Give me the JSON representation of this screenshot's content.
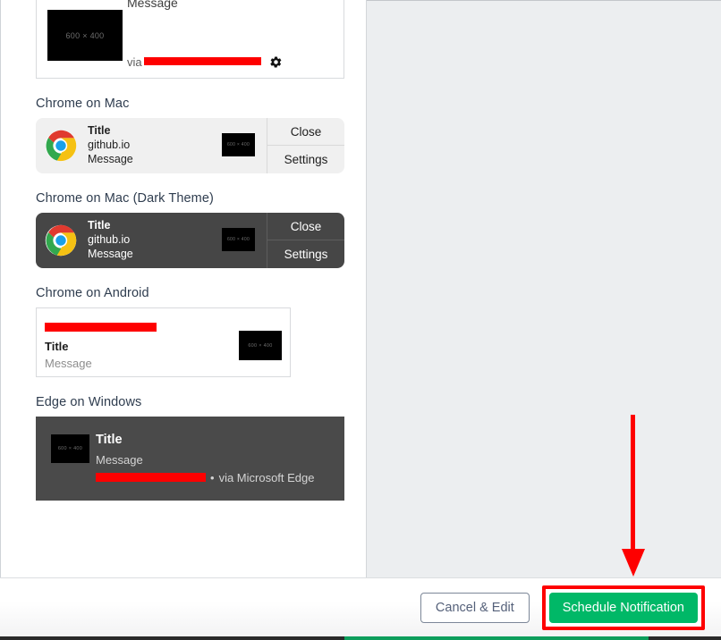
{
  "preview": {
    "sections": [
      {
        "heading": "",
        "type": "safari-partial",
        "card": {
          "message": "Message",
          "via_prefix": "via",
          "via_source": "[redacted]",
          "thumb_label": "600 × 400",
          "gear_icon": "gear-icon"
        }
      },
      {
        "heading": "Chrome on Mac",
        "type": "chrome-mac-light",
        "card": {
          "icon": "chrome-logo-icon",
          "title": "Title",
          "origin": "github.io",
          "message": "Message",
          "thumb_label": "600 × 400",
          "close_label": "Close",
          "settings_label": "Settings"
        }
      },
      {
        "heading": "Chrome on Mac (Dark Theme)",
        "type": "chrome-mac-dark",
        "card": {
          "icon": "chrome-logo-icon",
          "title": "Title",
          "origin": "github.io",
          "message": "Message",
          "thumb_label": "600 × 400",
          "close_label": "Close",
          "settings_label": "Settings"
        }
      },
      {
        "heading": "Chrome on Android",
        "type": "chrome-android",
        "card": {
          "origin": "[redacted]",
          "title": "Title",
          "message": "Message",
          "thumb_label": "600 × 400"
        }
      },
      {
        "heading": "Edge on Windows",
        "type": "edge-windows",
        "card": {
          "title": "Title",
          "message": "Message",
          "origin": "[redacted]",
          "separator": "•",
          "via": "via Microsoft Edge",
          "thumb_label": "600 × 400"
        }
      }
    ]
  },
  "footer": {
    "cancel_label": "Cancel & Edit",
    "schedule_label": "Schedule Notification"
  },
  "annotation": {
    "arrow": "down-arrow-annotation",
    "highlight": "schedule-button-highlight",
    "color": "#fe0000"
  },
  "colors": {
    "accent_green": "#00b867",
    "annotation_red": "#fe0000",
    "heading_text": "#2f3d4f",
    "right_panel": "#eceef0",
    "dark_card": "#4a4a4a",
    "mac_dark_card": "#464646",
    "mac_light_card": "#f0f0f0"
  }
}
